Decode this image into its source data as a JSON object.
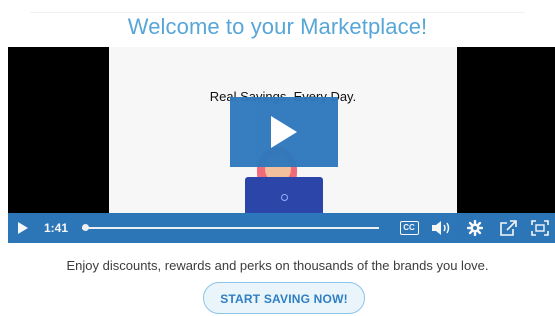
{
  "page": {
    "title": "Welcome to your Marketplace!"
  },
  "video": {
    "headline": "Real Savings. Every Day.",
    "current_time": "1:41",
    "cc_label": "CC",
    "progress_fraction": 0.0
  },
  "tagline": "Enjoy discounts, rewards and perks on thousands of the brands you love.",
  "cta": {
    "label": "START SAVING NOW!"
  },
  "colors": {
    "accent": "#2e79bd",
    "title": "#58a6d8",
    "cta_text": "#2f7fc3",
    "cta_border": "#8cc4ea"
  },
  "icons": [
    "play-icon",
    "closed-captions-icon",
    "volume-icon",
    "settings-icon",
    "share-icon",
    "fullscreen-icon"
  ]
}
